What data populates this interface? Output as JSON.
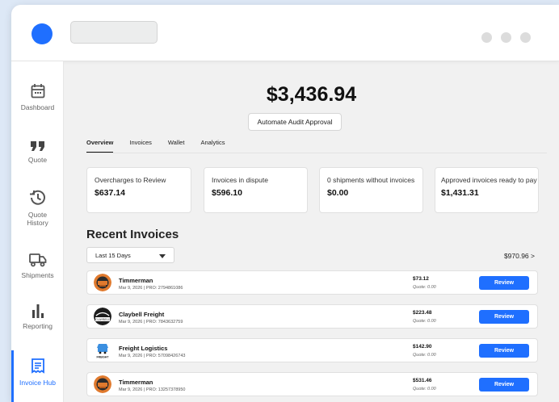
{
  "colors": {
    "accent": "#1f6fff",
    "background": "#dde8f6",
    "panel": "#f1f1f1"
  },
  "sidebar": {
    "items": [
      {
        "label": "Dashboard",
        "icon": "calendar-icon"
      },
      {
        "label": "Quote",
        "icon": "quote-icon"
      },
      {
        "label": "Quote History",
        "icon": "history-icon"
      },
      {
        "label": "Shipments",
        "icon": "truck-icon"
      },
      {
        "label": "Reporting",
        "icon": "bar-chart-icon"
      },
      {
        "label": "Invoice Hub",
        "icon": "receipt-icon",
        "active": true
      }
    ]
  },
  "main": {
    "total": "$3,436.94",
    "automate_label": "Automate Audit Approval",
    "tabs": [
      "Overview",
      "Invoices",
      "Wallet",
      "Analytics"
    ],
    "active_tab": "Overview",
    "cards": [
      {
        "label": "Overcharges to Review",
        "value": "$637.14"
      },
      {
        "label": "Invoices in dispute",
        "value": "$596.10"
      },
      {
        "label": "0 shipments without invoices",
        "value": "$0.00"
      },
      {
        "label": "Approved invoices ready to pay",
        "value": "$1,431.31"
      }
    ],
    "recent_title": "Recent Invoices",
    "filter_value": "Last 15 Days",
    "summary": "$970.96 >",
    "review_label": "Review",
    "invoices": [
      {
        "carrier": "Timmerman",
        "meta": "Mar 9, 2026 | PRO: 2794861086",
        "amount": "$73.12",
        "quote": "Quote: 0.00",
        "logo": "timmerman-logo-icon"
      },
      {
        "carrier": "Claybell Freight",
        "meta": "Mar 9, 2026 | PRO: 7843632759",
        "amount": "$223.48",
        "quote": "Quote: 0.00",
        "logo": "claybell-logo-icon",
        "logo_text": "CLAYBELL"
      },
      {
        "carrier": "Freight Logistics",
        "meta": "Mar 9, 2026 | PRO: 57098426743",
        "amount": "$142.90",
        "quote": "Quote: 0.00",
        "logo": "freight-logistics-logo-icon",
        "logo_text": "FREIGHT"
      },
      {
        "carrier": "Timmerman",
        "meta": "Mar 9, 2026 | PRO: 13257378950",
        "amount": "$531.46",
        "quote": "Quote: 0.00",
        "logo": "timmerman-logo-icon"
      }
    ]
  }
}
